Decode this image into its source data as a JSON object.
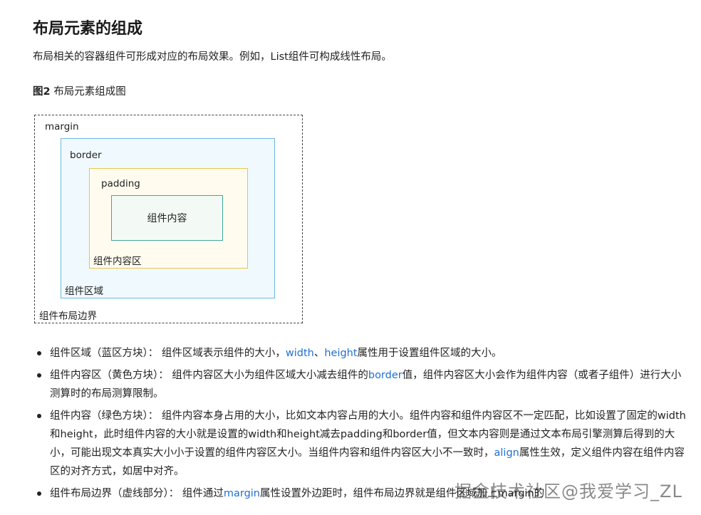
{
  "heading": "布局元素的组成",
  "intro": "布局相关的容器组件可形成对应的布局效果。例如，List组件可构成线性布局。",
  "figure": {
    "label": "图2",
    "caption": "布局元素组成图",
    "margin_label": "margin",
    "border_label": "border",
    "padding_label": "padding",
    "content_text": "组件内容",
    "content_area_label": "组件内容区",
    "component_area_label": "组件区域",
    "layout_boundary_label": "组件布局边界"
  },
  "bullets": [
    {
      "title": "组件区域（蓝区方块）：",
      "t1": " 组件区域表示组件的大小，",
      "l1": "width",
      "t2": "、",
      "l2": "height",
      "t3": "属性用于设置组件区域的大小。"
    },
    {
      "title": "组件内容区（黄色方块）：",
      "t1": " 组件内容区大小为组件区域大小减去组件的",
      "l1": "border",
      "t2": "值，组件内容区大小会作为组件内容（或者子组件）进行大小测算时的布局测算限制。"
    },
    {
      "title": "组件内容（绿色方块）：",
      "t1": " 组件内容本身占用的大小，比如文本内容占用的大小。组件内容和组件内容区不一定匹配，比如设置了固定的width和height，此时组件内容的大小就是设置的width和height减去padding和border值，但文本内容则是通过文本布局引擎测算后得到的大小，可能出现文本真实大小小于设置的组件内容区大小。当组件内容和组件内容区大小不一致时，",
      "l1": "align",
      "t2": "属性生效，定义组件内容在组件内容区的对齐方式，如居中对齐。"
    },
    {
      "title": "组件布局边界（虚线部分）：",
      "t1": " 组件通过",
      "l1": "margin",
      "t2": "属性设置外边距时，组件布局边界就是组件区域加上margin的"
    }
  ],
  "watermark": "掘金技术社区@我爱学习_ZL",
  "colors": {
    "link": "#1f6fd1",
    "border_box": "#6bb8dc",
    "padding_box": "#e8c44c",
    "content_box": "#3fa89a"
  }
}
